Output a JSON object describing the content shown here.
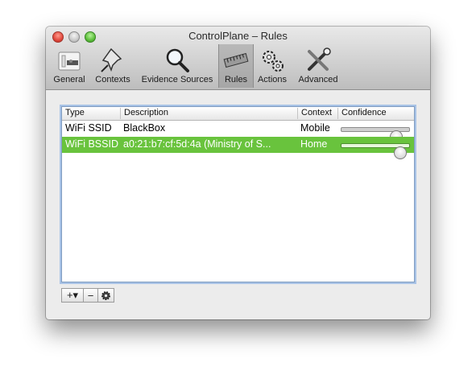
{
  "window": {
    "title": "ControlPlane – Rules"
  },
  "toolbar": {
    "items": [
      {
        "label": "General",
        "icon": "switch-icon"
      },
      {
        "label": "Contexts",
        "icon": "pushpin-icon"
      },
      {
        "label": "Evidence Sources",
        "icon": "magnifier-icon"
      },
      {
        "label": "Rules",
        "icon": "ruler-icon",
        "selected": true
      },
      {
        "label": "Actions",
        "icon": "gears-icon"
      },
      {
        "label": "Advanced",
        "icon": "tools-icon"
      }
    ]
  },
  "table": {
    "columns": [
      "Type",
      "Description",
      "Context",
      "Confidence"
    ],
    "rows": [
      {
        "type": "WiFi SSID",
        "description": "BlackBox",
        "context": "Mobile",
        "confidence": 0.85,
        "selected": false
      },
      {
        "type": "WiFi BSSID",
        "description": "a0:21:b7:cf:5d:4a (Ministry of S...",
        "context": "Home",
        "confidence": 0.92,
        "selected": true
      }
    ]
  },
  "bottom_buttons": {
    "add": "+▾",
    "remove": "−",
    "settings": "gear-icon"
  },
  "colors": {
    "selection": "#69c33d",
    "focus_ring": "#a9c3e6"
  }
}
